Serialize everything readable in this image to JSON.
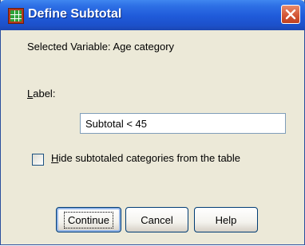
{
  "window": {
    "title": "Define Subtotal",
    "app_icon": "spss-table-icon",
    "close_icon": "close-icon"
  },
  "dialog": {
    "selected_variable_text": "Selected Variable: Age category",
    "label_caption": "Label:",
    "label_caption_mnemonic": "L",
    "label_caption_rest": "abel:",
    "label_value": "Subtotal < 45",
    "hide_checkbox": {
      "checked": false,
      "mnemonic": "H",
      "rest": "ide subtotaled categories from the table"
    }
  },
  "buttons": {
    "continue": "Continue",
    "cancel": "Cancel",
    "help": "Help"
  },
  "colors": {
    "titlebar": "#1f5ad9",
    "dialog_bg": "#ece9d8",
    "close_button": "#d25434"
  }
}
